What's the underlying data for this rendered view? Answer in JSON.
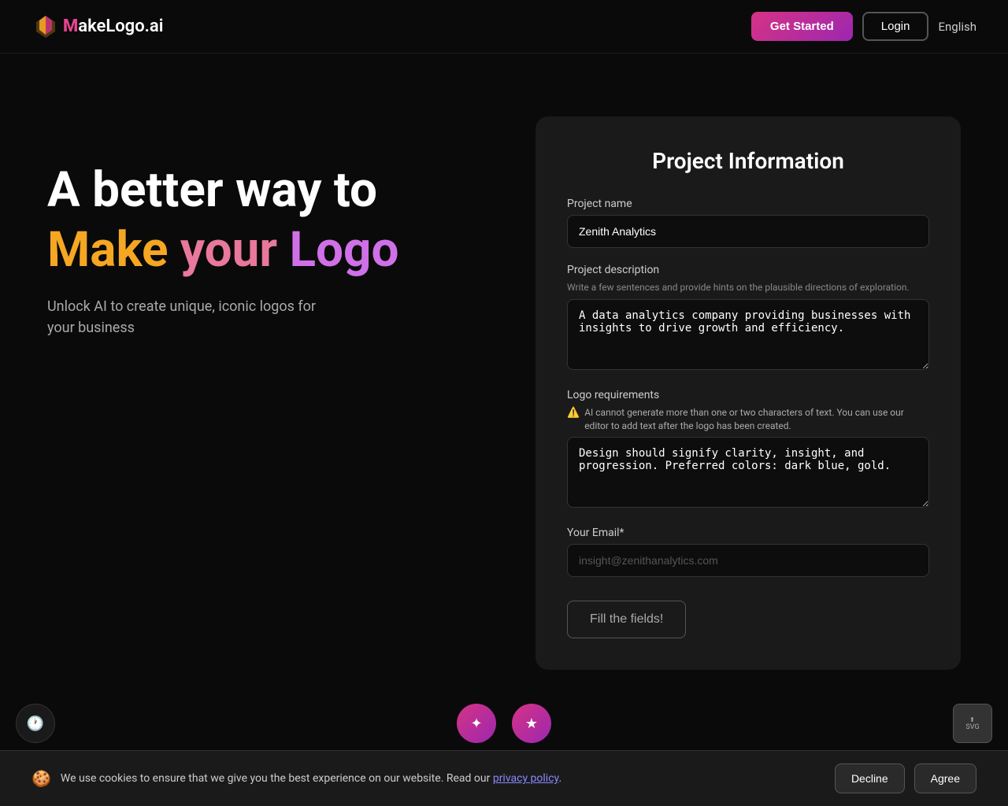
{
  "navbar": {
    "logo_text": "akeLogo.ai",
    "logo_letter": "M",
    "get_started_label": "Get Started",
    "login_label": "Login",
    "language_label": "English"
  },
  "hero": {
    "line1": "A better way to",
    "word_make": "Make",
    "word_your": "your",
    "word_logo": "Logo",
    "subtitle": "Unlock AI to create unique, iconic logos for your business"
  },
  "form": {
    "title": "Project Information",
    "project_name_label": "Project name",
    "project_name_value": "Zenith Analytics",
    "project_description_label": "Project description",
    "project_description_hint": "Write a few sentences and provide hints on the plausible directions of exploration.",
    "project_description_value": "A data analytics company providing businesses with insights to drive growth and efficiency.",
    "logo_requirements_label": "Logo requirements",
    "logo_requirements_warning": "AI cannot generate more than one or two characters of text. You can use our editor to add text after the logo has been created.",
    "logo_requirements_value": "Design should signify clarity, insight, and progression. Preferred colors: dark blue, gold.",
    "email_label": "Your Email*",
    "email_placeholder": "insight@zenithanalytics.com",
    "submit_label": "Fill the fields!"
  },
  "cookie": {
    "text": "We use cookies to ensure that we give you the best experience on our website. Read our",
    "link_text": "privacy policy",
    "decline_label": "Decline",
    "agree_label": "Agree"
  }
}
